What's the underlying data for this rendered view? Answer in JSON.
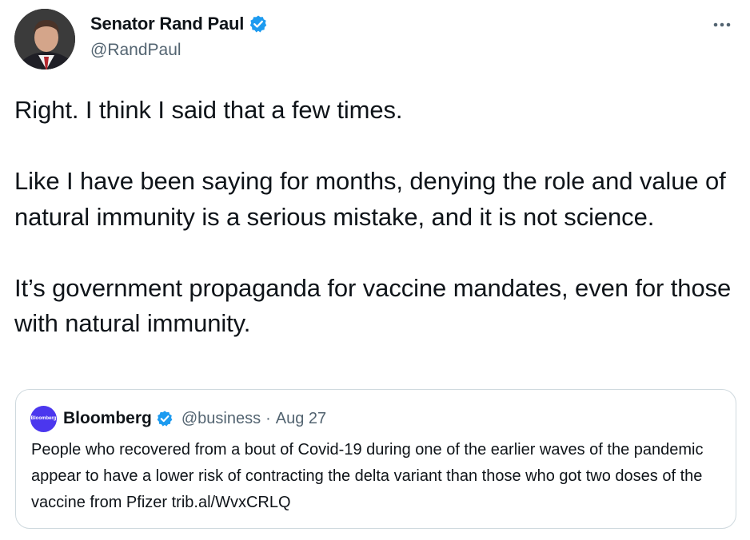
{
  "author": {
    "name": "Senator Rand Paul",
    "handle": "@RandPaul",
    "verified_icon": "verified-badge-icon",
    "verified_color": "#1d9bf0"
  },
  "menu": {
    "icon": "more-horizontal-icon"
  },
  "tweet": {
    "paragraphs": [
      "Right. I think I said that a few times.",
      "Like I have been saying for months, denying the role and value of natural immunity is a serious mistake, and it is not science.",
      "It’s government propaganda for vaccine mandates, even for those with natural immunity."
    ]
  },
  "quoted_tweet": {
    "author_name": "Bloomberg",
    "logo_text": "Bloomberg",
    "logo_color": "#4b37ee",
    "handle": "@business",
    "separator": "·",
    "date": "Aug 27",
    "text": "People who recovered from a bout of Covid-19 during one of the earlier waves of the pandemic appear to have a lower risk of contracting the delta variant than those who got two doses of the vaccine from Pfizer trib.al/WvxCRLQ"
  },
  "colors": {
    "text": "#0f1419",
    "secondary": "#536471",
    "border": "#cfd9de"
  }
}
